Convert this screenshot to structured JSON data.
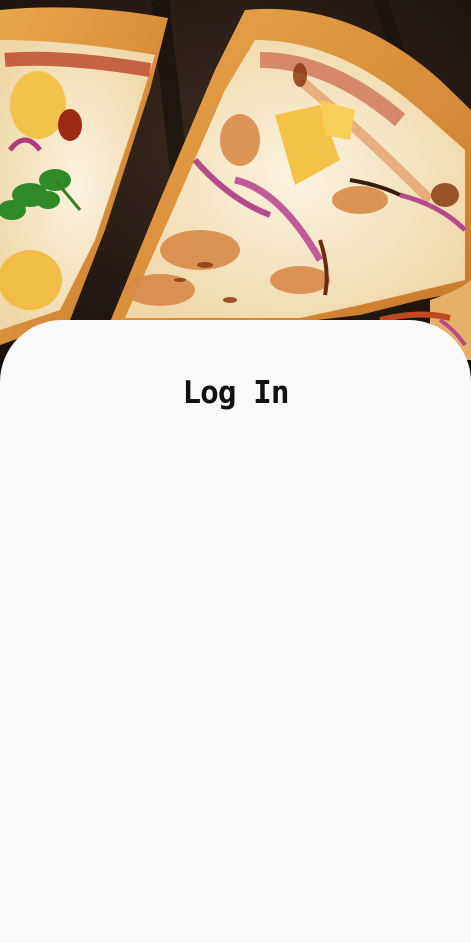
{
  "hero": {
    "image": "pizza-photo",
    "alt_icon": "pizza-icon"
  },
  "login": {
    "title": "Log In"
  },
  "colors": {
    "sheet_background": "#fafafa",
    "title_text": "#111111",
    "board": "#2a1d16"
  }
}
